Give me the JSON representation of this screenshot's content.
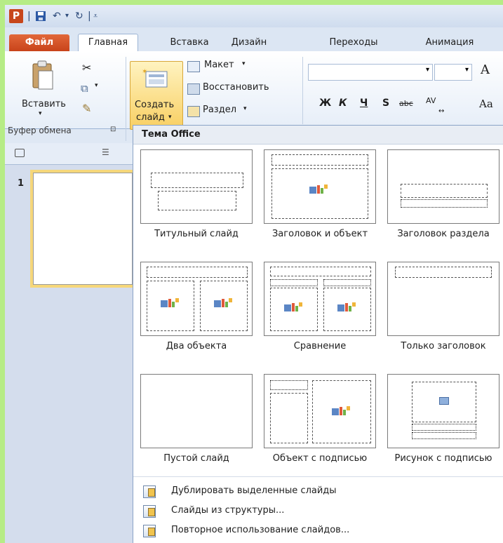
{
  "title_bar": {
    "app_logo_letter": "P",
    "qat_icons": [
      "save-icon",
      "undo-icon",
      "redo-icon",
      "customize-icon"
    ]
  },
  "tabs": [
    {
      "label": "Файл"
    },
    {
      "label": "Главная"
    },
    {
      "label": "Вставка"
    },
    {
      "label": "Дизайн"
    },
    {
      "label": "Переходы"
    },
    {
      "label": "Анимация"
    }
  ],
  "ribbon": {
    "paste_label": "Вставить",
    "clipboard_group": "Буфер обмена",
    "new_slide_line1": "Создать",
    "new_slide_line2": "слайд",
    "layout_label": "Макет",
    "reset_label": "Восстановить",
    "section_label": "Раздел",
    "font_grow": "A",
    "font_buttons": [
      "Ж",
      "К",
      "Ч",
      "S",
      "abc",
      "AV",
      "Aa"
    ]
  },
  "slide_pane": {
    "slide_number": "1"
  },
  "gallery": {
    "header": "Тема Office",
    "layouts": [
      {
        "label": "Титульный слайд"
      },
      {
        "label": "Заголовок и объект"
      },
      {
        "label": "Заголовок раздела"
      },
      {
        "label": "Два объекта"
      },
      {
        "label": "Сравнение"
      },
      {
        "label": "Только заголовок"
      },
      {
        "label": "Пустой слайд"
      },
      {
        "label": "Объект с подписью"
      },
      {
        "label": "Рисунок с подписью"
      }
    ],
    "menu": [
      {
        "label": "Дублировать выделенные слайды"
      },
      {
        "label": "Слайды из структуры..."
      },
      {
        "label": "Повторное использование слайдов..."
      }
    ]
  }
}
